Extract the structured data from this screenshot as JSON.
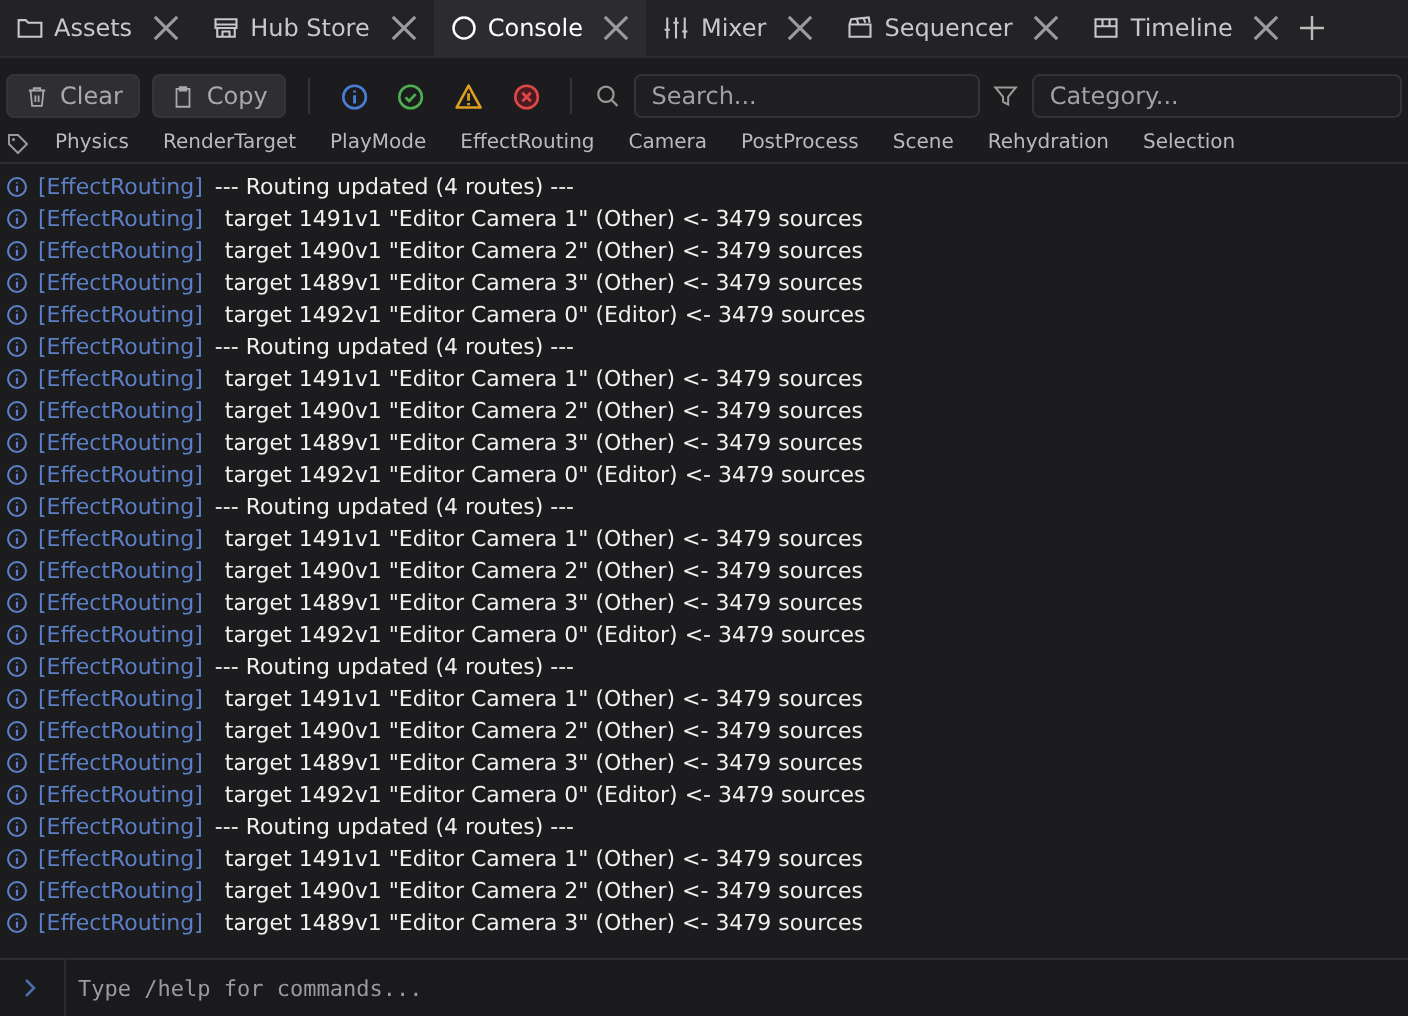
{
  "tabs": [
    {
      "label": "Assets",
      "kind": "folder",
      "selected": false
    },
    {
      "label": "Hub Store",
      "kind": "store",
      "selected": false
    },
    {
      "label": "Console",
      "kind": "circle",
      "selected": true
    },
    {
      "label": "Mixer",
      "kind": "sliders",
      "selected": false
    },
    {
      "label": "Sequencer",
      "kind": "clapper",
      "selected": false
    },
    {
      "label": "Timeline",
      "kind": "film",
      "selected": false
    }
  ],
  "toolbar": {
    "buttons": [
      {
        "label": "Clear",
        "kind": "trash"
      },
      {
        "label": "Copy",
        "kind": "clipboard"
      }
    ],
    "levels": [
      {
        "kind": "info"
      },
      {
        "kind": "success"
      },
      {
        "kind": "warning"
      },
      {
        "kind": "error"
      }
    ],
    "search": {
      "placeholder": "Search..."
    },
    "category": {
      "placeholder": "Category..."
    }
  },
  "tags": [
    "Physics",
    "RenderTarget",
    "PlayMode",
    "EffectRouting",
    "Camera",
    "PostProcess",
    "Scene",
    "Rehydration",
    "Selection"
  ],
  "log": [
    {
      "kind": "header",
      "source": "[EffectRouting]",
      "message": "--- Routing updated (4 routes) ---"
    },
    {
      "kind": "target",
      "source": "[EffectRouting]",
      "message": "target 1491v1 \"Editor Camera 1\" (Other) <- 3479 sources"
    },
    {
      "kind": "target",
      "source": "[EffectRouting]",
      "message": "target 1490v1 \"Editor Camera 2\" (Other) <- 3479 sources"
    },
    {
      "kind": "target",
      "source": "[EffectRouting]",
      "message": "target 1489v1 \"Editor Camera 3\" (Other) <- 3479 sources"
    },
    {
      "kind": "target",
      "source": "[EffectRouting]",
      "message": "target 1492v1 \"Editor Camera 0\" (Editor) <- 3479 sources"
    },
    {
      "kind": "header",
      "source": "[EffectRouting]",
      "message": "--- Routing updated (4 routes) ---"
    },
    {
      "kind": "target",
      "source": "[EffectRouting]",
      "message": "target 1491v1 \"Editor Camera 1\" (Other) <- 3479 sources"
    },
    {
      "kind": "target",
      "source": "[EffectRouting]",
      "message": "target 1490v1 \"Editor Camera 2\" (Other) <- 3479 sources"
    },
    {
      "kind": "target",
      "source": "[EffectRouting]",
      "message": "target 1489v1 \"Editor Camera 3\" (Other) <- 3479 sources"
    },
    {
      "kind": "target",
      "source": "[EffectRouting]",
      "message": "target 1492v1 \"Editor Camera 0\" (Editor) <- 3479 sources"
    },
    {
      "kind": "header",
      "source": "[EffectRouting]",
      "message": "--- Routing updated (4 routes) ---"
    },
    {
      "kind": "target",
      "source": "[EffectRouting]",
      "message": "target 1491v1 \"Editor Camera 1\" (Other) <- 3479 sources"
    },
    {
      "kind": "target",
      "source": "[EffectRouting]",
      "message": "target 1490v1 \"Editor Camera 2\" (Other) <- 3479 sources"
    },
    {
      "kind": "target",
      "source": "[EffectRouting]",
      "message": "target 1489v1 \"Editor Camera 3\" (Other) <- 3479 sources"
    },
    {
      "kind": "target",
      "source": "[EffectRouting]",
      "message": "target 1492v1 \"Editor Camera 0\" (Editor) <- 3479 sources"
    },
    {
      "kind": "header",
      "source": "[EffectRouting]",
      "message": "--- Routing updated (4 routes) ---"
    },
    {
      "kind": "target",
      "source": "[EffectRouting]",
      "message": "target 1491v1 \"Editor Camera 1\" (Other) <- 3479 sources"
    },
    {
      "kind": "target",
      "source": "[EffectRouting]",
      "message": "target 1490v1 \"Editor Camera 2\" (Other) <- 3479 sources"
    },
    {
      "kind": "target",
      "source": "[EffectRouting]",
      "message": "target 1489v1 \"Editor Camera 3\" (Other) <- 3479 sources"
    },
    {
      "kind": "target",
      "source": "[EffectRouting]",
      "message": "target 1492v1 \"Editor Camera 0\" (Editor) <- 3479 sources"
    },
    {
      "kind": "header",
      "source": "[EffectRouting]",
      "message": "--- Routing updated (4 routes) ---"
    },
    {
      "kind": "target",
      "source": "[EffectRouting]",
      "message": "target 1491v1 \"Editor Camera 1\" (Other) <- 3479 sources"
    },
    {
      "kind": "target",
      "source": "[EffectRouting]",
      "message": "target 1490v1 \"Editor Camera 2\" (Other) <- 3479 sources"
    },
    {
      "kind": "target",
      "source": "[EffectRouting]",
      "message": "target 1489v1 \"Editor Camera 3\" (Other) <- 3479 sources"
    }
  ],
  "command": {
    "placeholder": "Type /help for commands..."
  }
}
